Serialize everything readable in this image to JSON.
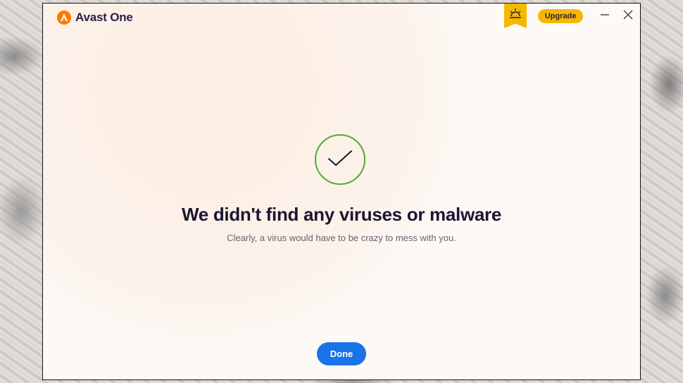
{
  "app": {
    "name": "Avast One",
    "brand_color": "#ff7800",
    "title_color": "#2b1e4a"
  },
  "header": {
    "notification_icon": "sunrise-icon",
    "upgrade_label": "Upgrade",
    "upgrade_color": "#f5b800",
    "minimize_icon": "minimize-icon",
    "close_icon": "close-icon"
  },
  "result": {
    "status_icon": "checkmark-icon",
    "status_color": "#4caf2a",
    "title": "We didn't find any viruses or malware",
    "subtitle": "Clearly, a virus would have to be crazy to mess with you."
  },
  "footer": {
    "done_label": "Done",
    "done_color": "#1a73e8"
  }
}
